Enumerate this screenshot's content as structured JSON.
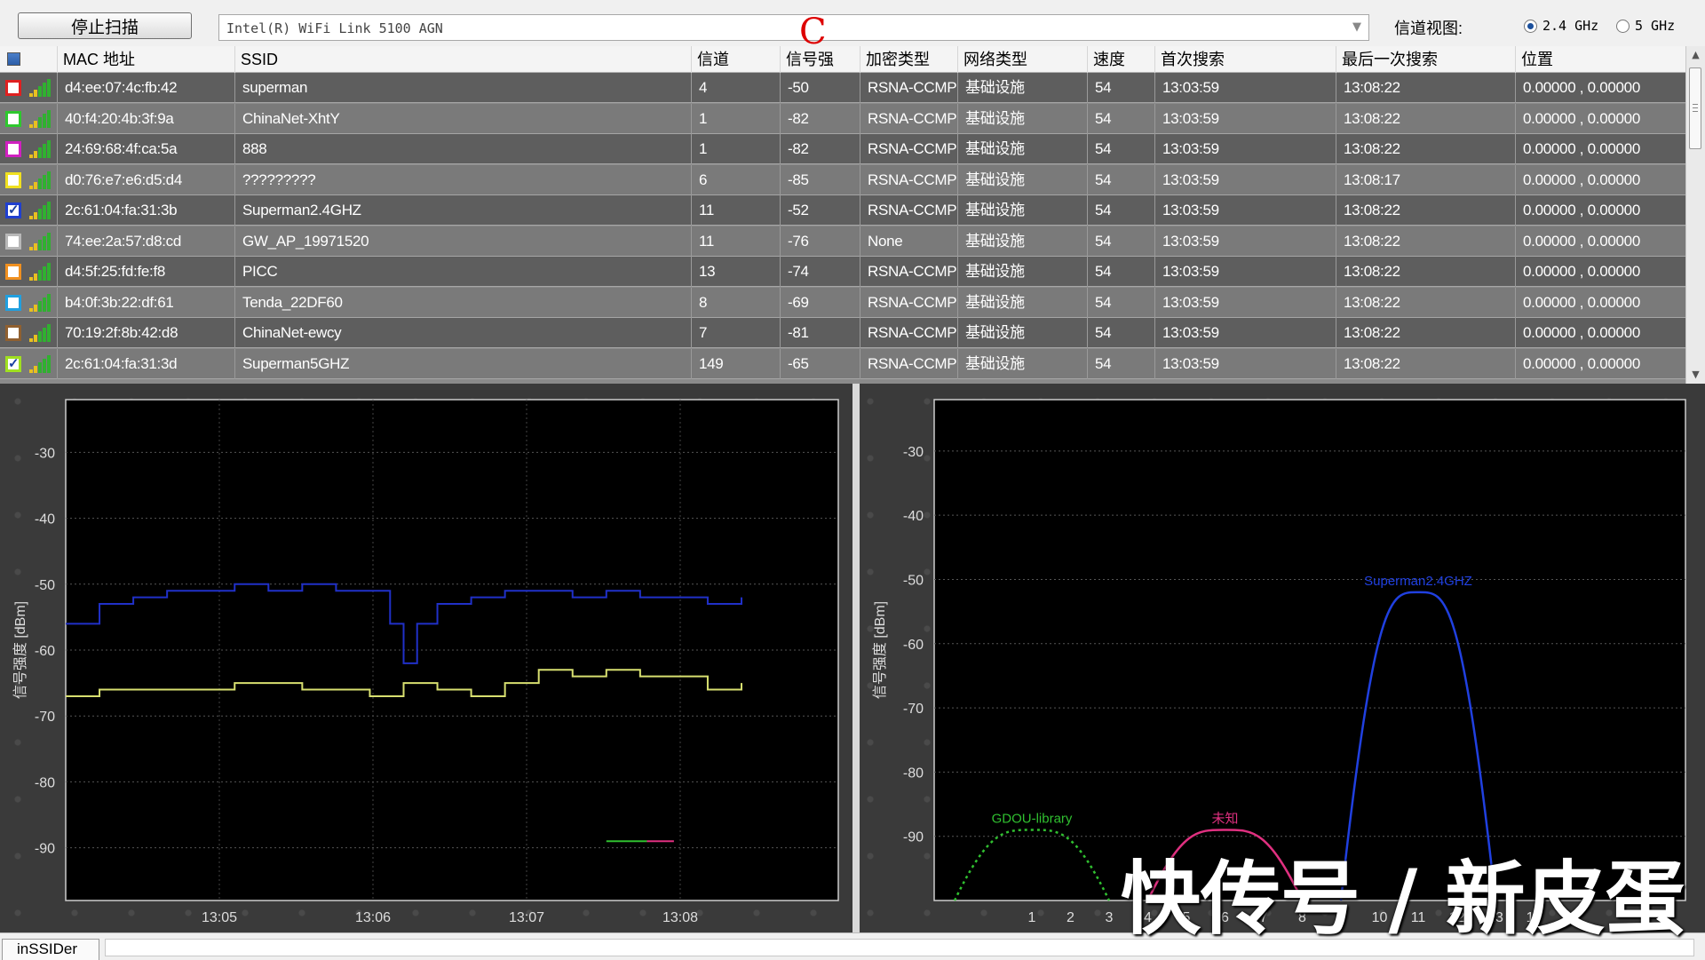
{
  "toolbar": {
    "stop_scan_label": "停止扫描",
    "adapter_value": "Intel(R) WiFi Link 5100 AGN",
    "channel_view_label": "信道视图:",
    "band_options": [
      {
        "label": "2.4 GHz",
        "selected": true
      },
      {
        "label": "5 GHz",
        "selected": false
      }
    ]
  },
  "table": {
    "headers": [
      "MAC 地址",
      "SSID",
      "信道",
      "信号强",
      "加密类型",
      "网络类型",
      "速度",
      "首次搜索",
      "最后一次搜索",
      "位置"
    ],
    "rows": [
      {
        "color": "#e02020",
        "checked": false,
        "mac": "d4:ee:07:4c:fb:42",
        "ssid": "superman",
        "channel": "4",
        "rssi": "-50",
        "security": "RSNA-CCMP",
        "network": "基础设施",
        "speed": "54",
        "first_seen": "13:03:59",
        "last_seen": "13:08:22",
        "location": "0.00000 , 0.00000"
      },
      {
        "color": "#2ec82e",
        "checked": false,
        "mac": "40:f4:20:4b:3f:9a",
        "ssid": "ChinaNet-XhtY",
        "channel": "1",
        "rssi": "-82",
        "security": "RSNA-CCMP",
        "network": "基础设施",
        "speed": "54",
        "first_seen": "13:03:59",
        "last_seen": "13:08:22",
        "location": "0.00000 , 0.00000"
      },
      {
        "color": "#d020c0",
        "checked": false,
        "mac": "24:69:68:4f:ca:5a",
        "ssid": "888",
        "channel": "1",
        "rssi": "-82",
        "security": "RSNA-CCMP",
        "network": "基础设施",
        "speed": "54",
        "first_seen": "13:03:59",
        "last_seen": "13:08:22",
        "location": "0.00000 , 0.00000"
      },
      {
        "color": "#f0e020",
        "checked": false,
        "mac": "d0:76:e7:e6:d5:d4",
        "ssid": "?????????",
        "channel": "6",
        "rssi": "-85",
        "security": "RSNA-CCMP",
        "network": "基础设施",
        "speed": "54",
        "first_seen": "13:03:59",
        "last_seen": "13:08:17",
        "location": "0.00000 , 0.00000"
      },
      {
        "color": "#2040d0",
        "checked": true,
        "mac": "2c:61:04:fa:31:3b",
        "ssid": "Superman2.4GHZ",
        "channel": "11",
        "rssi": "-52",
        "security": "RSNA-CCMP",
        "network": "基础设施",
        "speed": "54",
        "first_seen": "13:03:59",
        "last_seen": "13:08:22",
        "location": "0.00000 , 0.00000"
      },
      {
        "color": "#b8b8b8",
        "checked": false,
        "mac": "74:ee:2a:57:d8:cd",
        "ssid": "GW_AP_19971520",
        "channel": "11",
        "rssi": "-76",
        "security": "None",
        "network": "基础设施",
        "speed": "54",
        "first_seen": "13:03:59",
        "last_seen": "13:08:22",
        "location": "0.00000 , 0.00000"
      },
      {
        "color": "#f09020",
        "checked": false,
        "mac": "d4:5f:25:fd:fe:f8",
        "ssid": "PICC",
        "channel": "13",
        "rssi": "-74",
        "security": "RSNA-CCMP",
        "network": "基础设施",
        "speed": "54",
        "first_seen": "13:03:59",
        "last_seen": "13:08:22",
        "location": "0.00000 , 0.00000"
      },
      {
        "color": "#20a0e0",
        "checked": false,
        "mac": "b4:0f:3b:22:df:61",
        "ssid": "Tenda_22DF60",
        "channel": "8",
        "rssi": "-69",
        "security": "RSNA-CCMP",
        "network": "基础设施",
        "speed": "54",
        "first_seen": "13:03:59",
        "last_seen": "13:08:22",
        "location": "0.00000 , 0.00000"
      },
      {
        "color": "#906030",
        "checked": false,
        "mac": "70:19:2f:8b:42:d8",
        "ssid": "ChinaNet-ewcy",
        "channel": "7",
        "rssi": "-81",
        "security": "RSNA-CCMP",
        "network": "基础设施",
        "speed": "54",
        "first_seen": "13:03:59",
        "last_seen": "13:08:22",
        "location": "0.00000 , 0.00000"
      },
      {
        "color": "#a0e020",
        "checked": true,
        "mac": "2c:61:04:fa:31:3d",
        "ssid": "Superman5GHZ",
        "channel": "149",
        "rssi": "-65",
        "security": "RSNA-CCMP",
        "network": "基础设施",
        "speed": "54",
        "first_seen": "13:03:59",
        "last_seen": "13:08:22",
        "location": "0.00000 , 0.00000"
      }
    ]
  },
  "chart_data": [
    {
      "type": "line",
      "ylabel": "信号强度 [dBm]",
      "ylim": [
        -98,
        -22
      ],
      "y_ticks": [
        -30,
        -40,
        -50,
        -60,
        -70,
        -80,
        -90
      ],
      "x_ticks": [
        "13:05",
        "13:06",
        "13:07",
        "13:08"
      ],
      "series": [
        {
          "color": "#2030c8",
          "x": [
            0,
            5,
            10,
            15,
            20,
            25,
            30,
            35,
            40,
            45,
            48,
            50,
            52,
            55,
            60,
            65,
            70,
            75,
            80,
            85,
            90,
            95,
            100
          ],
          "y": [
            -56,
            -53,
            -52,
            -51,
            -51,
            -50,
            -51,
            -50,
            -51,
            -51,
            -56,
            -62,
            -56,
            -53,
            -52,
            -51,
            -51,
            -52,
            -51,
            -52,
            -52,
            -53,
            -52
          ]
        },
        {
          "color": "#d8e070",
          "x": [
            0,
            5,
            10,
            15,
            20,
            25,
            30,
            35,
            40,
            45,
            50,
            55,
            60,
            65,
            70,
            75,
            80,
            85,
            90,
            95,
            100
          ],
          "y": [
            -67,
            -66,
            -66,
            -66,
            -66,
            -65,
            -65,
            -66,
            -66,
            -67,
            -65,
            -66,
            -67,
            -65,
            -63,
            -64,
            -63,
            -64,
            -64,
            -66,
            -65
          ]
        },
        {
          "color": "#30c030",
          "x": [
            80,
            86
          ],
          "y": [
            -89,
            -89
          ]
        },
        {
          "color": "#e03080",
          "x": [
            86,
            90
          ],
          "y": [
            -89,
            -89
          ]
        }
      ]
    },
    {
      "type": "line",
      "ylabel": "信号强度 [dBm]",
      "ylim": [
        -100,
        -22
      ],
      "y_ticks": [
        -30,
        -40,
        -50,
        -60,
        -70,
        -80,
        -90
      ],
      "x_ticks": [
        "1",
        "2",
        "3",
        "4",
        "5",
        "6",
        "7",
        "8",
        "9",
        "10",
        "11",
        "12",
        "13",
        "14"
      ],
      "series": [
        {
          "name": "GDOU-library",
          "color": "#30c030",
          "dashed": true,
          "center": 1,
          "peak": -89
        },
        {
          "name": "未知",
          "color": "#e03080",
          "dashed": false,
          "center": 6,
          "peak": -89
        },
        {
          "name": "Superman2.4GHZ",
          "color": "#2040e0",
          "dashed": false,
          "center": 11,
          "peak": -52
        }
      ]
    }
  ],
  "status": {
    "tab_label": "inSSIDer"
  },
  "overlay": {
    "mark": "C",
    "watermark": "快传号 / 新皮蛋"
  }
}
